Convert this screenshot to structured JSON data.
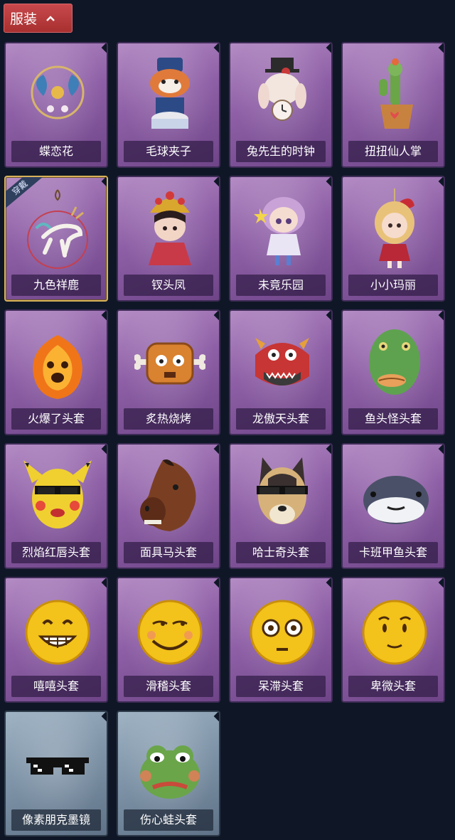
{
  "header": {
    "title": "服装"
  },
  "badge": "穿戴",
  "items": [
    {
      "label": "蝶恋花",
      "icon": "butterfly-flower-ornament-icon",
      "theme": "purple"
    },
    {
      "label": "毛球夹子",
      "icon": "raccoon-drummer-icon",
      "theme": "purple"
    },
    {
      "label": "兔先生的时钟",
      "icon": "rabbit-clock-icon",
      "theme": "purple"
    },
    {
      "label": "扭扭仙人掌",
      "icon": "cactus-pot-icon",
      "theme": "purple"
    },
    {
      "label": "九色祥鹿",
      "icon": "deer-charm-icon",
      "theme": "purple",
      "selected": true
    },
    {
      "label": "钗头凤",
      "icon": "phoenix-crown-doll-icon",
      "theme": "purple"
    },
    {
      "label": "未竟乐园",
      "icon": "fairy-doll-icon",
      "theme": "purple"
    },
    {
      "label": "小小玛丽",
      "icon": "mary-doll-icon",
      "theme": "purple"
    },
    {
      "label": "火爆了头套",
      "icon": "fire-mask-icon",
      "theme": "purple"
    },
    {
      "label": "炙热烧烤",
      "icon": "bbq-meat-icon",
      "theme": "purple"
    },
    {
      "label": "龙傲天头套",
      "icon": "dragon-mask-icon",
      "theme": "purple"
    },
    {
      "label": "鱼头怪头套",
      "icon": "fish-mask-icon",
      "theme": "purple"
    },
    {
      "label": "烈焰红唇头套",
      "icon": "yellow-mouse-mask-icon",
      "theme": "purple"
    },
    {
      "label": "面具马头套",
      "icon": "horse-mask-icon",
      "theme": "purple"
    },
    {
      "label": "哈士奇头套",
      "icon": "husky-mask-icon",
      "theme": "purple"
    },
    {
      "label": "卡班甲鱼头套",
      "icon": "round-fish-mask-icon",
      "theme": "purple"
    },
    {
      "label": "嘻嘻头套",
      "icon": "grin-emoji-mask-icon",
      "theme": "purple"
    },
    {
      "label": "滑稽头套",
      "icon": "funny-emoji-mask-icon",
      "theme": "purple"
    },
    {
      "label": "呆滞头套",
      "icon": "stunned-emoji-mask-icon",
      "theme": "purple"
    },
    {
      "label": "卑微头套",
      "icon": "humble-emoji-mask-icon",
      "theme": "purple"
    },
    {
      "label": "像素朋克墨镜",
      "icon": "pixel-sunglasses-icon",
      "theme": "blue"
    },
    {
      "label": "伤心蛙头套",
      "icon": "sad-frog-mask-icon",
      "theme": "blue"
    }
  ]
}
